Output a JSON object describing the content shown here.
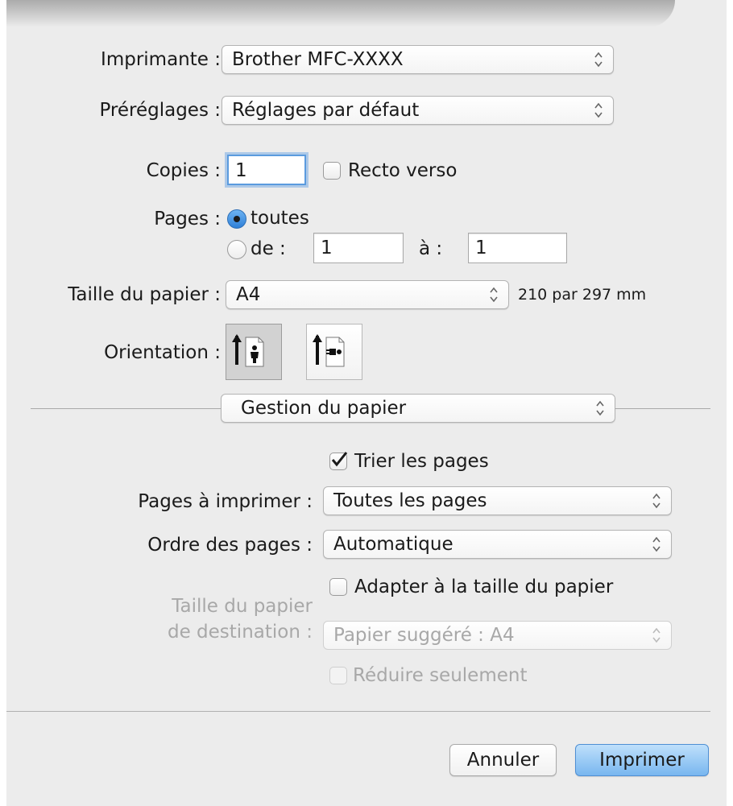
{
  "printer": {
    "label": "Imprimante :",
    "value": "Brother MFC-XXXX"
  },
  "presets": {
    "label": "Préréglages :",
    "value": "Réglages par défaut"
  },
  "copies": {
    "label": "Copies :",
    "value": "1",
    "duplex_label": "Recto verso",
    "duplex_checked": false
  },
  "pages": {
    "label": "Pages :",
    "all_label": "toutes",
    "range_label": "de :",
    "from": "1",
    "to_label": "à :",
    "to": "1",
    "selected": "all"
  },
  "paper_size": {
    "label": "Taille du papier :",
    "value": "A4",
    "dimensions": "210 par 297 mm"
  },
  "orientation": {
    "label": "Orientation :",
    "selected": "portrait",
    "options": [
      "portrait-icon",
      "landscape-icon"
    ]
  },
  "section": {
    "value": "Gestion du papier"
  },
  "collate": {
    "label": "Trier les pages",
    "checked": true
  },
  "pages_to_print": {
    "label": "Pages à imprimer :",
    "value": "Toutes les pages"
  },
  "page_order": {
    "label": "Ordre des pages :",
    "value": "Automatique"
  },
  "scale_to_fit": {
    "label": "Adapter à la taille du papier",
    "checked": false
  },
  "destination_paper": {
    "label_line1": "Taille du papier",
    "label_line2": "de destination :",
    "value": "Papier suggéré : A4",
    "disabled": true
  },
  "scale_down_only": {
    "label": "Réduire seulement",
    "checked": false,
    "disabled": true
  },
  "buttons": {
    "cancel": "Annuler",
    "print": "Imprimer"
  },
  "colors": {
    "accent": "#3b8ee0",
    "window": "#ececec",
    "disabled_text": "#a8a8a8"
  }
}
